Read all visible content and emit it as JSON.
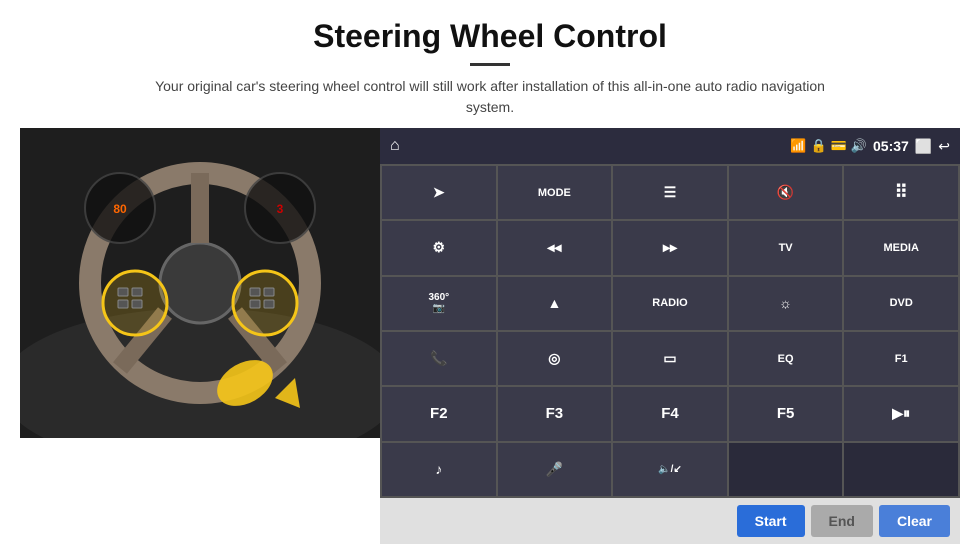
{
  "header": {
    "title": "Steering Wheel Control",
    "subtitle": "Your original car's steering wheel control will still work after installation of this all-in-one auto radio navigation system."
  },
  "topbar": {
    "time": "05:37"
  },
  "grid_buttons": [
    {
      "id": "btn-nav",
      "label": "➤",
      "row": 1,
      "col": 1
    },
    {
      "id": "btn-mode",
      "label": "MODE",
      "row": 1,
      "col": 2
    },
    {
      "id": "btn-list",
      "label": "≡",
      "row": 1,
      "col": 3
    },
    {
      "id": "btn-mute",
      "label": "🔇",
      "row": 1,
      "col": 4
    },
    {
      "id": "btn-apps",
      "label": "⊞",
      "row": 1,
      "col": 5
    },
    {
      "id": "btn-settings",
      "label": "⚙",
      "row": 2,
      "col": 1
    },
    {
      "id": "btn-prev",
      "label": "◀◀",
      "row": 2,
      "col": 2
    },
    {
      "id": "btn-next",
      "label": "▶▶",
      "row": 2,
      "col": 3
    },
    {
      "id": "btn-tv",
      "label": "TV",
      "row": 2,
      "col": 4
    },
    {
      "id": "btn-media",
      "label": "MEDIA",
      "row": 2,
      "col": 5
    },
    {
      "id": "btn-360",
      "label": "360°",
      "row": 3,
      "col": 1
    },
    {
      "id": "btn-eject",
      "label": "▲",
      "row": 3,
      "col": 2
    },
    {
      "id": "btn-radio",
      "label": "RADIO",
      "row": 3,
      "col": 3
    },
    {
      "id": "btn-bright",
      "label": "☼",
      "row": 3,
      "col": 4
    },
    {
      "id": "btn-dvd",
      "label": "DVD",
      "row": 3,
      "col": 5
    },
    {
      "id": "btn-phone",
      "label": "📞",
      "row": 4,
      "col": 1
    },
    {
      "id": "btn-nav2",
      "label": "◎",
      "row": 4,
      "col": 2
    },
    {
      "id": "btn-screen",
      "label": "▭",
      "row": 4,
      "col": 3
    },
    {
      "id": "btn-eq",
      "label": "EQ",
      "row": 4,
      "col": 4
    },
    {
      "id": "btn-f1",
      "label": "F1",
      "row": 4,
      "col": 5
    },
    {
      "id": "btn-f2",
      "label": "F2",
      "row": 5,
      "col": 1
    },
    {
      "id": "btn-f3",
      "label": "F3",
      "row": 5,
      "col": 2
    },
    {
      "id": "btn-f4",
      "label": "F4",
      "row": 5,
      "col": 3
    },
    {
      "id": "btn-f5",
      "label": "F5",
      "row": 5,
      "col": 4
    },
    {
      "id": "btn-playpause",
      "label": "▶⏸",
      "row": 5,
      "col": 5
    },
    {
      "id": "btn-music",
      "label": "♪",
      "row": 6,
      "col": 1
    },
    {
      "id": "btn-mic",
      "label": "🎤",
      "row": 6,
      "col": 2
    },
    {
      "id": "btn-volphone",
      "label": "🔈/↙",
      "row": 6,
      "col": 3
    }
  ],
  "bottom_actions": {
    "start_label": "Start",
    "end_label": "End",
    "clear_label": "Clear"
  }
}
